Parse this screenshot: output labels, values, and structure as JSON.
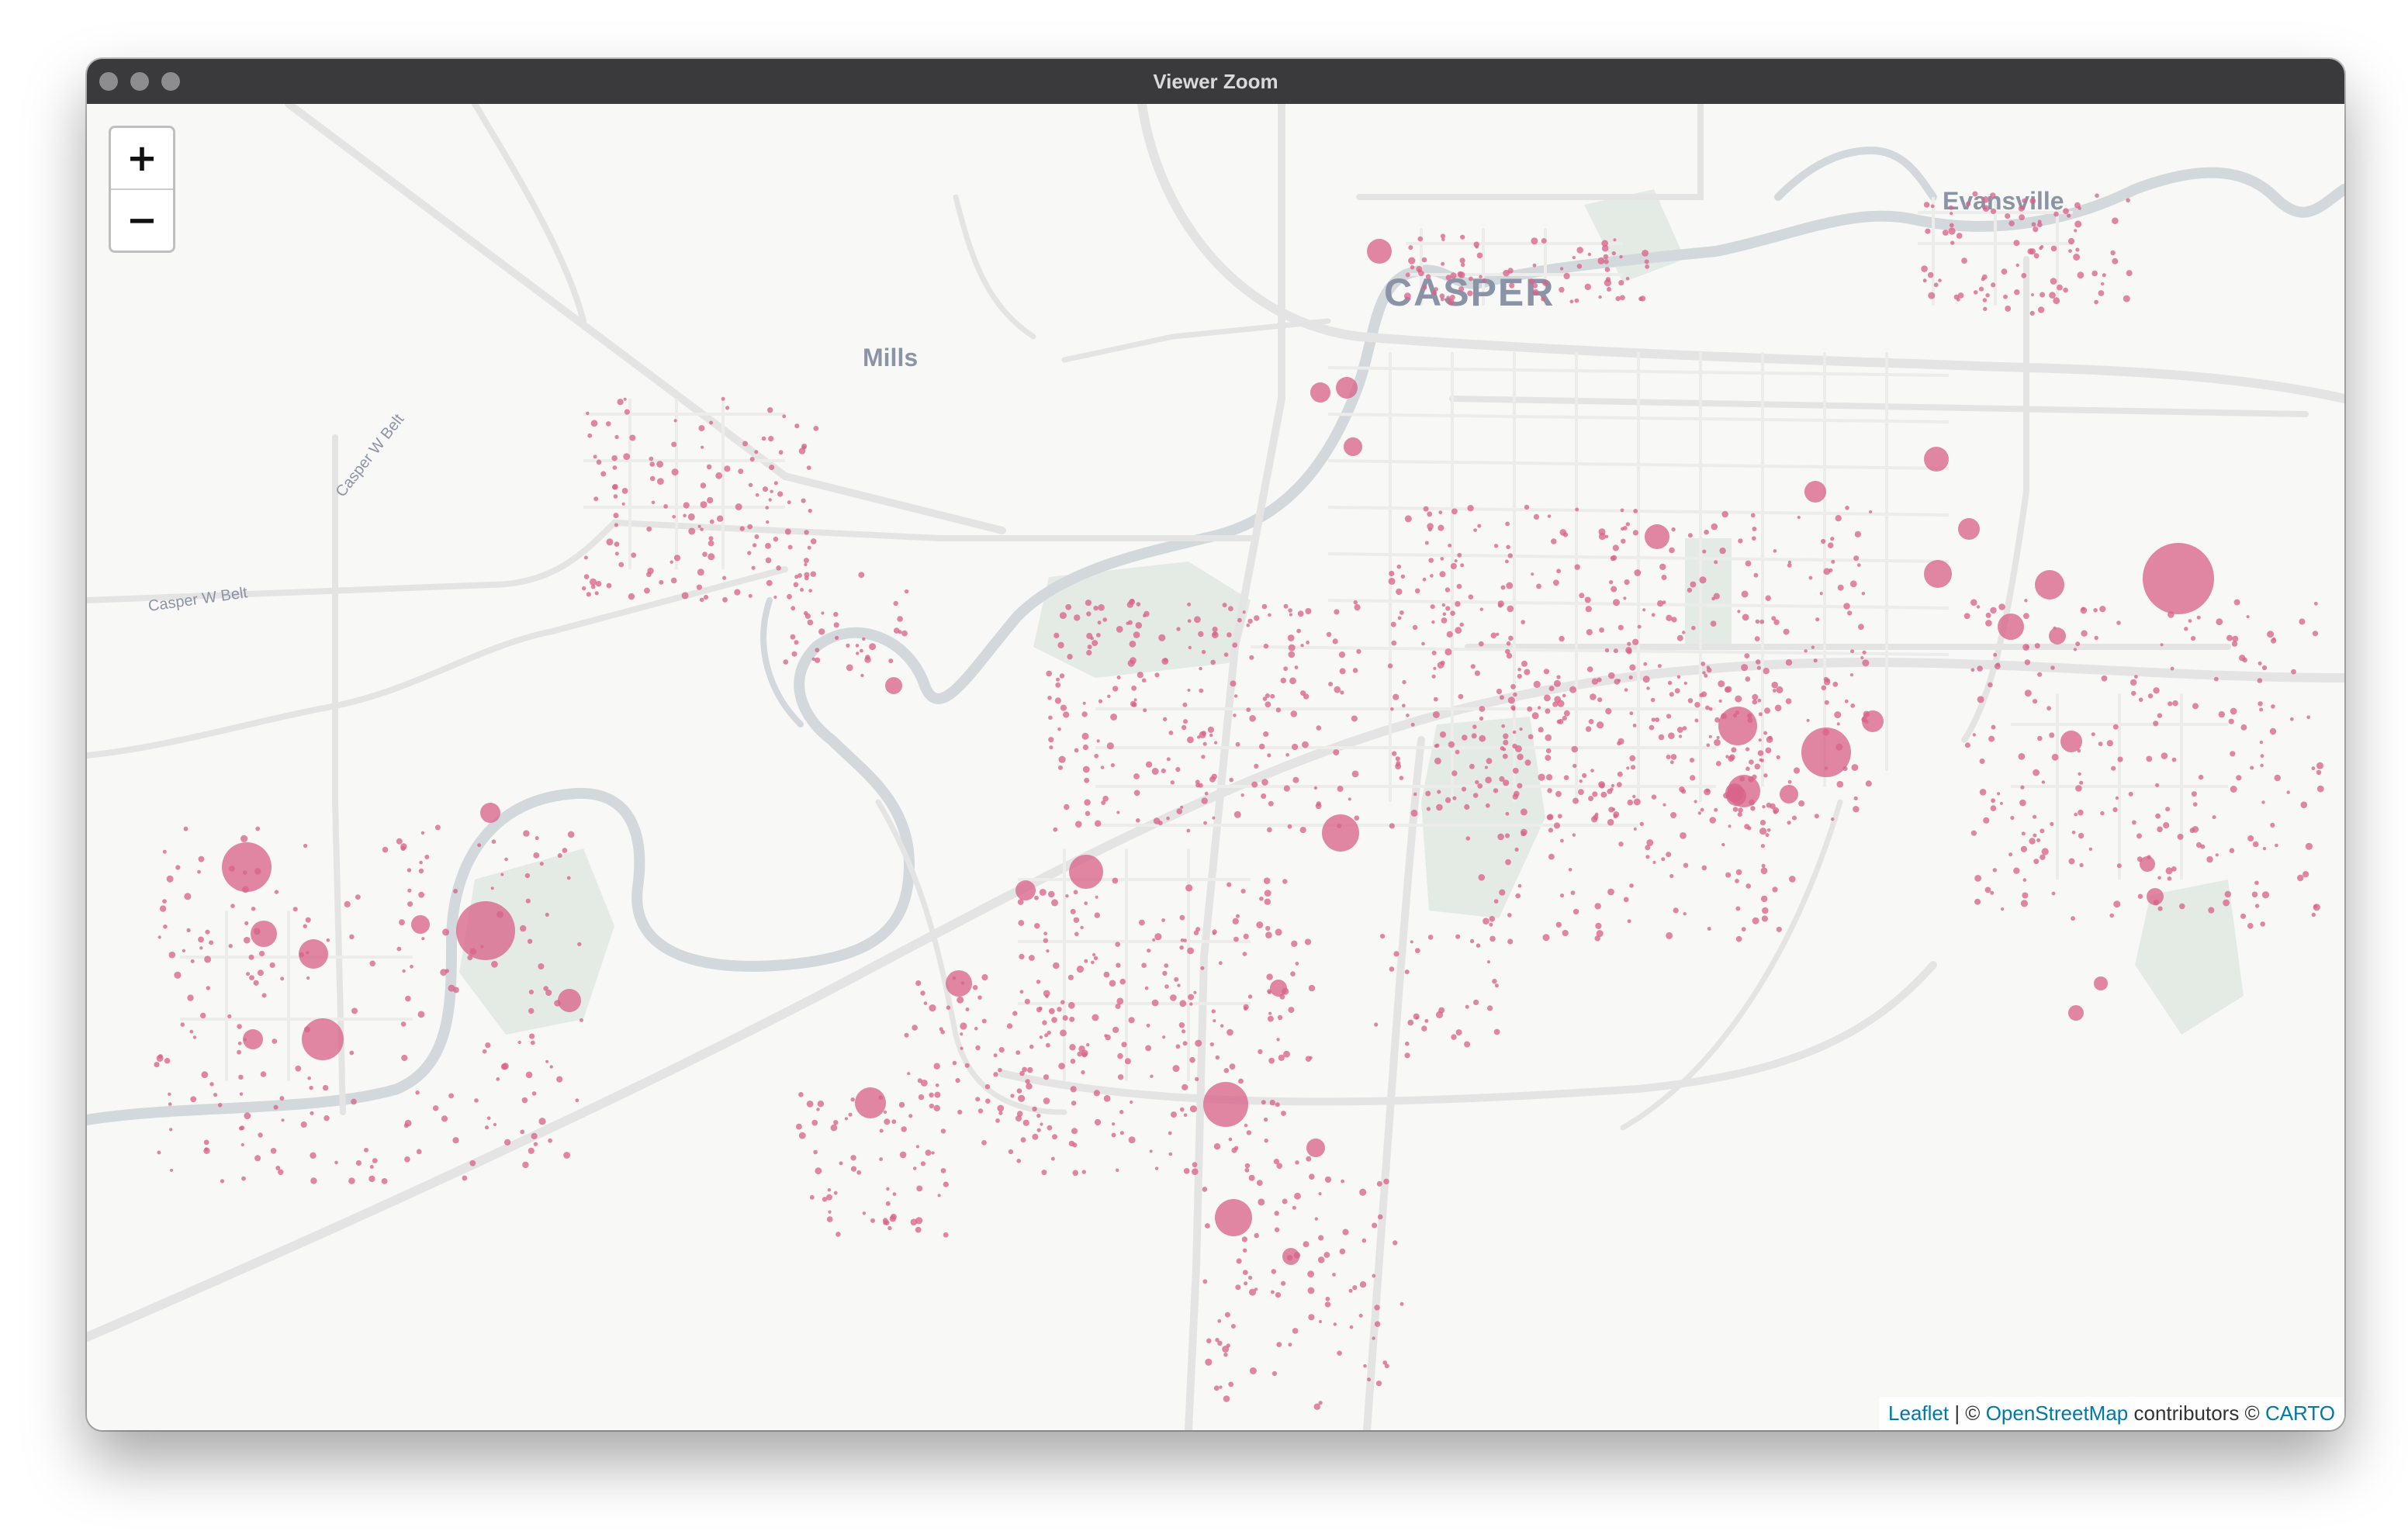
{
  "window": {
    "title": "Viewer Zoom"
  },
  "zoom": {
    "in_label": "+",
    "out_label": "−"
  },
  "place_labels": {
    "casper": "CASPER",
    "mills": "Mills",
    "evansville": "Evansville",
    "road_belt_1": "Casper W Belt",
    "road_belt_2": "Casper W Belt"
  },
  "attribution": {
    "leaflet": "Leaflet",
    "sep": " | © ",
    "osm": "OpenStreetMap",
    "contrib": " contributors © ",
    "carto": "CARTO"
  },
  "colors": {
    "marker": "#d9648a",
    "river": "#d2d8dc",
    "road": "#e6e6e6",
    "park": "#e4ebe5",
    "land": "#f8f8f7"
  }
}
